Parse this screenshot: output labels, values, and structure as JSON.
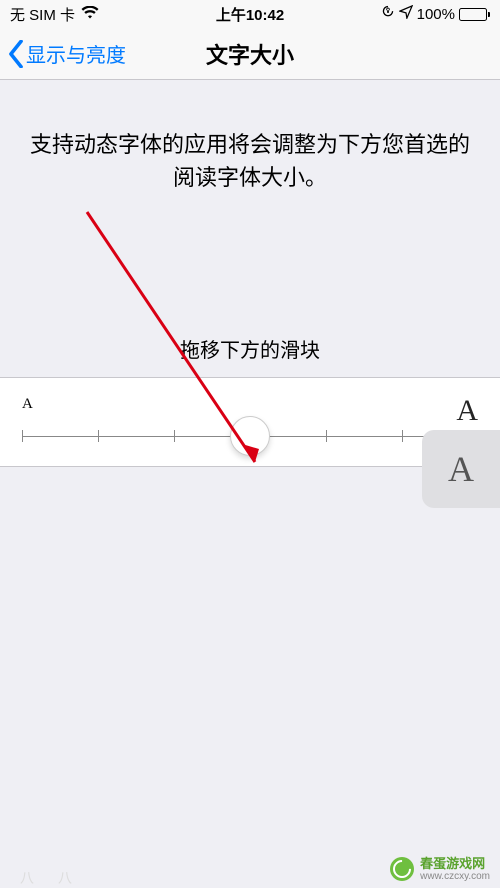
{
  "status": {
    "carrier": "无 SIM 卡",
    "time": "上午10:42",
    "battery_pct": "100%"
  },
  "nav": {
    "back_label": "显示与亮度",
    "title": "文字大小"
  },
  "body": {
    "description": "支持动态字体的应用将会调整为下方您首选的阅读字体大小。",
    "slider_instruction": "拖移下方的滑块",
    "small_a": "A",
    "large_a": "A"
  },
  "slider": {
    "ticks": 7,
    "position_index": 3
  },
  "badge": {
    "letter": "A"
  },
  "watermark": {
    "name": "春蛋游戏网",
    "url": "www.czcxy.com"
  },
  "colors": {
    "accent": "#007aff",
    "annotation": "#d90014"
  }
}
